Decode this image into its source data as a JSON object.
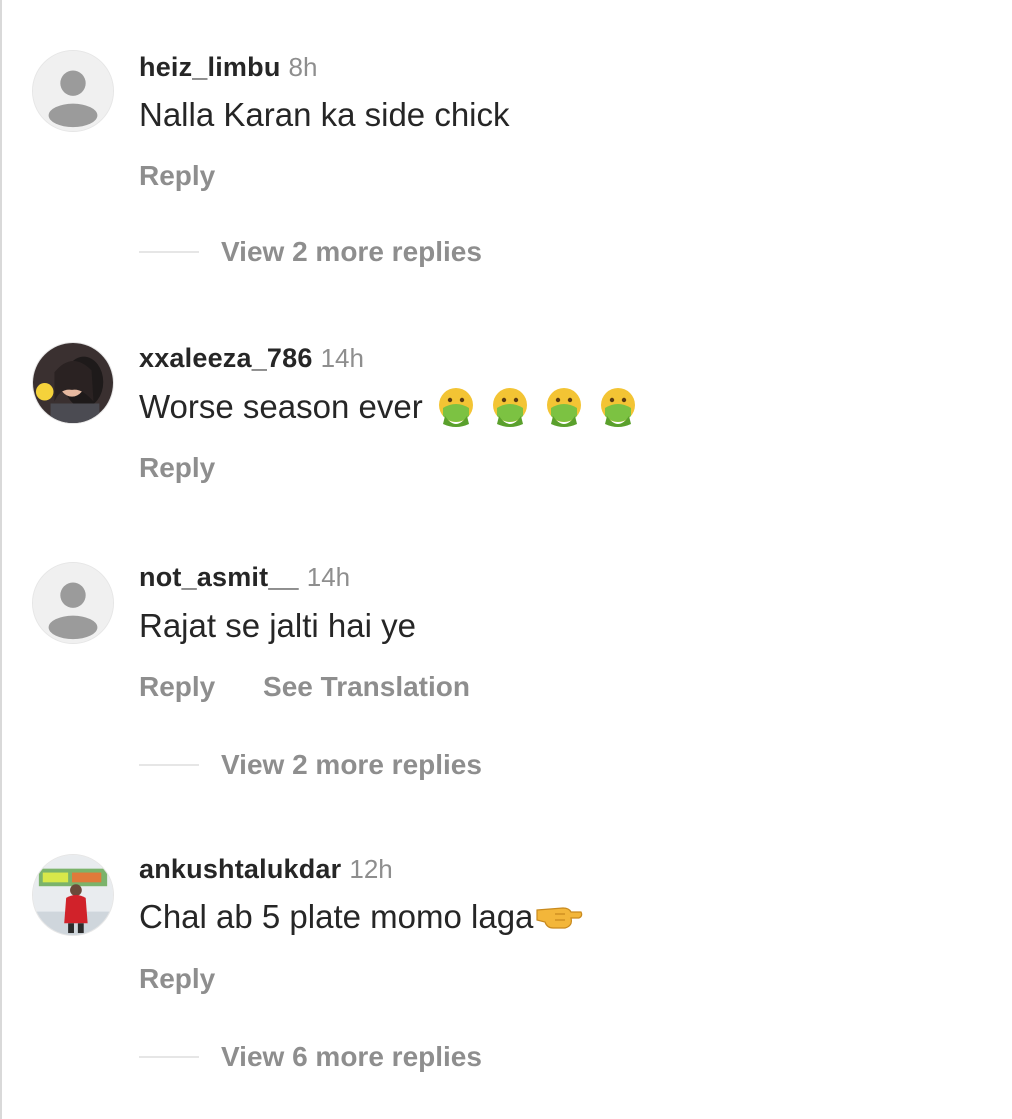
{
  "comments": [
    {
      "username": "heiz_limbu",
      "time": "8h",
      "text": "Nalla Karan ka side chick",
      "reply_label": "Reply",
      "more_replies": "View 2 more replies",
      "avatar": "default-avatar-icon"
    },
    {
      "username": "xxaleeza_786",
      "time": "14h",
      "text": "Worse season ever",
      "emojis": [
        "nauseated-face-icon",
        "nauseated-face-icon",
        "nauseated-face-icon",
        "nauseated-face-icon"
      ],
      "reply_label": "Reply",
      "avatar": "profile-photo"
    },
    {
      "username": "not_asmit__",
      "time": "14h",
      "text": "Rajat se jalti hai ye",
      "reply_label": "Reply",
      "translation_label": "See Translation",
      "more_replies": "View 2 more replies",
      "avatar": "default-avatar-icon"
    },
    {
      "username": "ankushtalukdar",
      "time": "12h",
      "text": "Chal ab 5 plate momo laga",
      "emojis": [
        "pointing-hand-icon"
      ],
      "reply_label": "Reply",
      "more_replies": "View 6 more replies",
      "avatar": "profile-photo"
    }
  ],
  "colors": {
    "username": "#262626",
    "secondary": "#8e8e8e",
    "divider": "#e6e6e6",
    "background": "#ffffff"
  }
}
